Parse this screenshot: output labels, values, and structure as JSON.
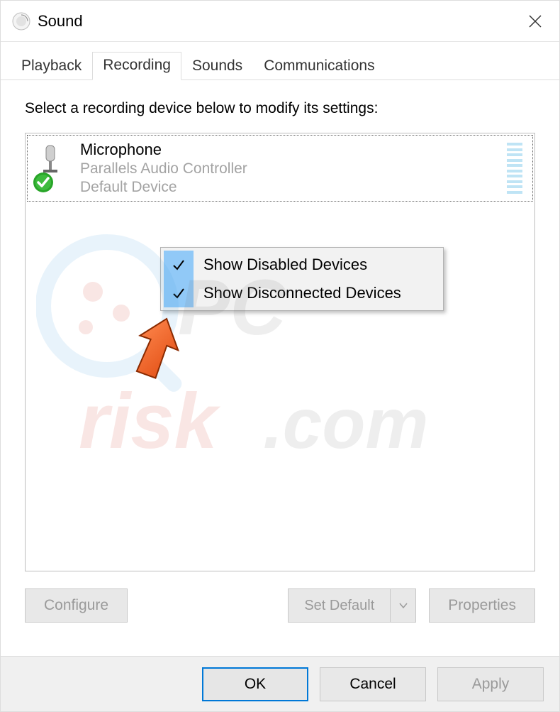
{
  "window": {
    "title": "Sound"
  },
  "tabs": [
    {
      "label": "Playback"
    },
    {
      "label": "Recording"
    },
    {
      "label": "Sounds"
    },
    {
      "label": "Communications"
    }
  ],
  "active_tab_index": 1,
  "instruction": "Select a recording device below to modify its settings:",
  "devices": [
    {
      "name": "Microphone",
      "controller": "Parallels Audio Controller",
      "status": "Default Device"
    }
  ],
  "context_menu": {
    "items": [
      {
        "label": "Show Disabled Devices",
        "checked": true
      },
      {
        "label": "Show Disconnected Devices",
        "checked": true
      }
    ]
  },
  "buttons": {
    "configure": "Configure",
    "set_default": "Set Default",
    "properties": "Properties"
  },
  "footer": {
    "ok": "OK",
    "cancel": "Cancel",
    "apply": "Apply"
  },
  "watermark": "pcrisk.com"
}
